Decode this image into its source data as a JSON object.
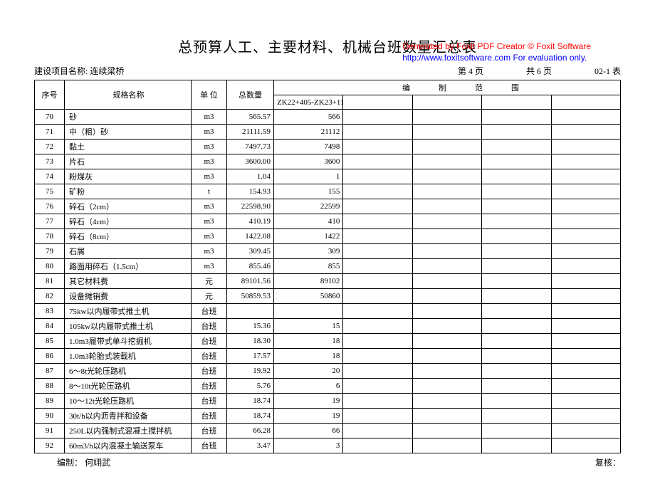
{
  "watermark": {
    "line1": "Generated by Foxit PDF Creator © Foxit Software",
    "line2": "http://www.foxitsoftware.com   For evaluation only."
  },
  "title": "总预算人工、主要材料、机械台班数量汇总表",
  "header": {
    "project_label": "建设项目名称:",
    "project_name": "连续梁桥",
    "page_info": "第 4 页",
    "total_pages": "共 6 页",
    "table_no": "02-1 表"
  },
  "scope": {
    "c1": "编",
    "c2": "制",
    "c3": "范",
    "c4": "围"
  },
  "columns": {
    "seq": "序号",
    "name": "规格名称",
    "unit": "单  位",
    "total": "总数量",
    "scope_val": "ZK22+405-ZK23+115"
  },
  "rows": [
    {
      "seq": "70",
      "name": "砂",
      "unit": "m3",
      "total": "565.57",
      "scope": "566"
    },
    {
      "seq": "71",
      "name": "中（粗）砂",
      "unit": "m3",
      "total": "21111.59",
      "scope": "21112"
    },
    {
      "seq": "72",
      "name": "黏土",
      "unit": "m3",
      "total": "7497.73",
      "scope": "7498"
    },
    {
      "seq": "73",
      "name": "片石",
      "unit": "m3",
      "total": "3600.00",
      "scope": "3600"
    },
    {
      "seq": "74",
      "name": "粉煤灰",
      "unit": "m3",
      "total": "1.04",
      "scope": "1"
    },
    {
      "seq": "75",
      "name": "矿粉",
      "unit": "t",
      "total": "154.93",
      "scope": "155"
    },
    {
      "seq": "76",
      "name": "碎石（2cm）",
      "unit": "m3",
      "total": "22598.90",
      "scope": "22599"
    },
    {
      "seq": "77",
      "name": "碎石（4cm）",
      "unit": "m3",
      "total": "410.19",
      "scope": "410"
    },
    {
      "seq": "78",
      "name": "碎石（8cm）",
      "unit": "m3",
      "total": "1422.08",
      "scope": "1422"
    },
    {
      "seq": "79",
      "name": "石屑",
      "unit": "m3",
      "total": "309.45",
      "scope": "309"
    },
    {
      "seq": "80",
      "name": "路面用碎石（1.5cm）",
      "unit": "m3",
      "total": "855.46",
      "scope": "855"
    },
    {
      "seq": "81",
      "name": "其它材料费",
      "unit": "元",
      "total": "89101.56",
      "scope": "89102"
    },
    {
      "seq": "82",
      "name": "设备摊销费",
      "unit": "元",
      "total": "50859.53",
      "scope": "50860"
    },
    {
      "seq": "83",
      "name": "75kw以内履带式推土机",
      "unit": "台班",
      "total": "",
      "scope": ""
    },
    {
      "seq": "84",
      "name": "105kw以内履带式推土机",
      "unit": "台班",
      "total": "15.36",
      "scope": "15"
    },
    {
      "seq": "85",
      "name": "1.0m3履带式单斗挖掘机",
      "unit": "台班",
      "total": "18.30",
      "scope": "18"
    },
    {
      "seq": "86",
      "name": "1.0m3轮胎式装载机",
      "unit": "台班",
      "total": "17.57",
      "scope": "18"
    },
    {
      "seq": "87",
      "name": "6～8t光轮压路机",
      "unit": "台班",
      "total": "19.92",
      "scope": "20"
    },
    {
      "seq": "88",
      "name": "8～10t光轮压路机",
      "unit": "台班",
      "total": "5.76",
      "scope": "6"
    },
    {
      "seq": "89",
      "name": "10～12t光轮压路机",
      "unit": "台班",
      "total": "18.74",
      "scope": "19"
    },
    {
      "seq": "90",
      "name": "30t/h以内沥青拌和设备",
      "unit": "台班",
      "total": "18.74",
      "scope": "19"
    },
    {
      "seq": "91",
      "name": "250L以内强制式混凝土搅拌机",
      "unit": "台班",
      "total": "66.28",
      "scope": "66"
    },
    {
      "seq": "92",
      "name": "60m3/h以内混凝土输送泵车",
      "unit": "台班",
      "total": "3.47",
      "scope": "3"
    }
  ],
  "footer": {
    "compiler_label": "编制：",
    "compiler_name": "何翊武",
    "reviewer_label": "复核："
  }
}
